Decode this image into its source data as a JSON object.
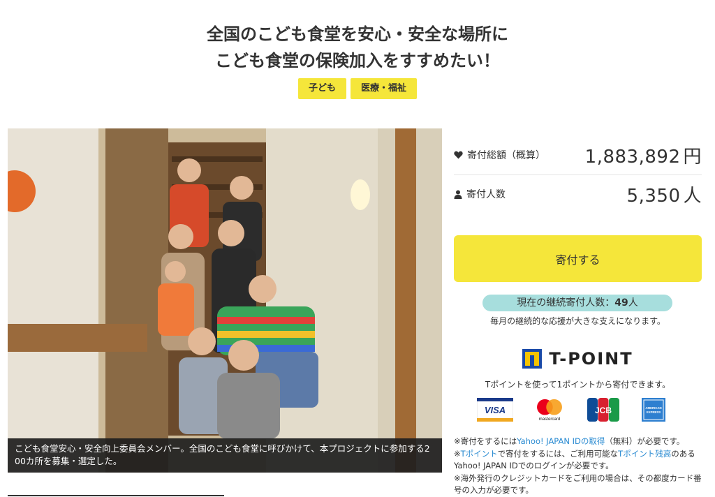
{
  "header": {
    "title_line1": "全国のこども食堂を安心・安全な場所に",
    "title_line2": "こども食堂の保険加入をすすめたい！",
    "tags": [
      "子ども",
      "医療・福祉"
    ]
  },
  "photo": {
    "caption_line1": "こども食堂安心・安全向上委員会メンバー。全国のこども食堂に呼びかけて、本プロジェクトに参加する2",
    "caption_line2": "00カ所を募集・選定した。"
  },
  "stats": {
    "total_label": "寄付総額（概算）",
    "total_value": "1,883,892",
    "total_unit": "円",
    "donors_label": "寄付人数",
    "donors_value": "5,350",
    "donors_unit": "人"
  },
  "donate": {
    "button_label": "寄付する",
    "continuous_prefix": "現在の継続寄付人数：",
    "continuous_count": "49",
    "continuous_unit": "人",
    "continuous_note": "毎月の継続的な応援が大きな支えになります。"
  },
  "tpoint": {
    "logo_text": "T-POINT",
    "note": "Tポイントを使って1ポイントから寄付できます。"
  },
  "cards": {
    "visa": "VISA",
    "mastercard": "mastercard",
    "jcb": "JCB",
    "amex": "AMERICAN EXPRESS"
  },
  "notes": {
    "n1_prefix": "※寄付をするには",
    "n1_link": "Yahoo! JAPAN IDの取得",
    "n1_suffix": "（無料）が必要です。",
    "n2_prefix": "※",
    "n2_link1": "Tポイント",
    "n2_mid": "で寄付をするには、ご利用可能な",
    "n2_link2": "Tポイント残高",
    "n2_suffix": "のあるYahoo! JAPAN IDでのログインが必要です。",
    "n3": "※海外発行のクレジットカードをご利用の場合は、その都度カード番号の入力が必要です。"
  },
  "colors": {
    "accent_yellow": "#f5e63a",
    "badge_teal": "#a7dedd",
    "link_blue": "#2a8bd2"
  },
  "icons": {
    "total": "heart-icon",
    "donors": "person-icon"
  }
}
